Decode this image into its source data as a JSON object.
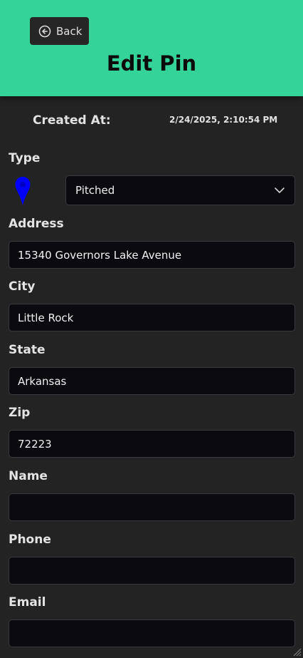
{
  "header": {
    "back_label": "Back",
    "title": "Edit Pin",
    "bg_color": "#34d399"
  },
  "meta": {
    "created_label": "Created At:",
    "created_value": "2/24/2025, 2:10:54 PM"
  },
  "type_field": {
    "label": "Type",
    "selected": "Pitched",
    "pin_color": "#0000ff",
    "icon": "map-pin-icon"
  },
  "fields": {
    "address": {
      "label": "Address",
      "value": "15340 Governors Lake Avenue"
    },
    "city": {
      "label": "City",
      "value": "Little Rock"
    },
    "state": {
      "label": "State",
      "value": "Arkansas"
    },
    "zip": {
      "label": "Zip",
      "value": "72223"
    },
    "name": {
      "label": "Name",
      "value": ""
    },
    "phone": {
      "label": "Phone",
      "value": ""
    },
    "email": {
      "label": "Email",
      "value": ""
    }
  }
}
